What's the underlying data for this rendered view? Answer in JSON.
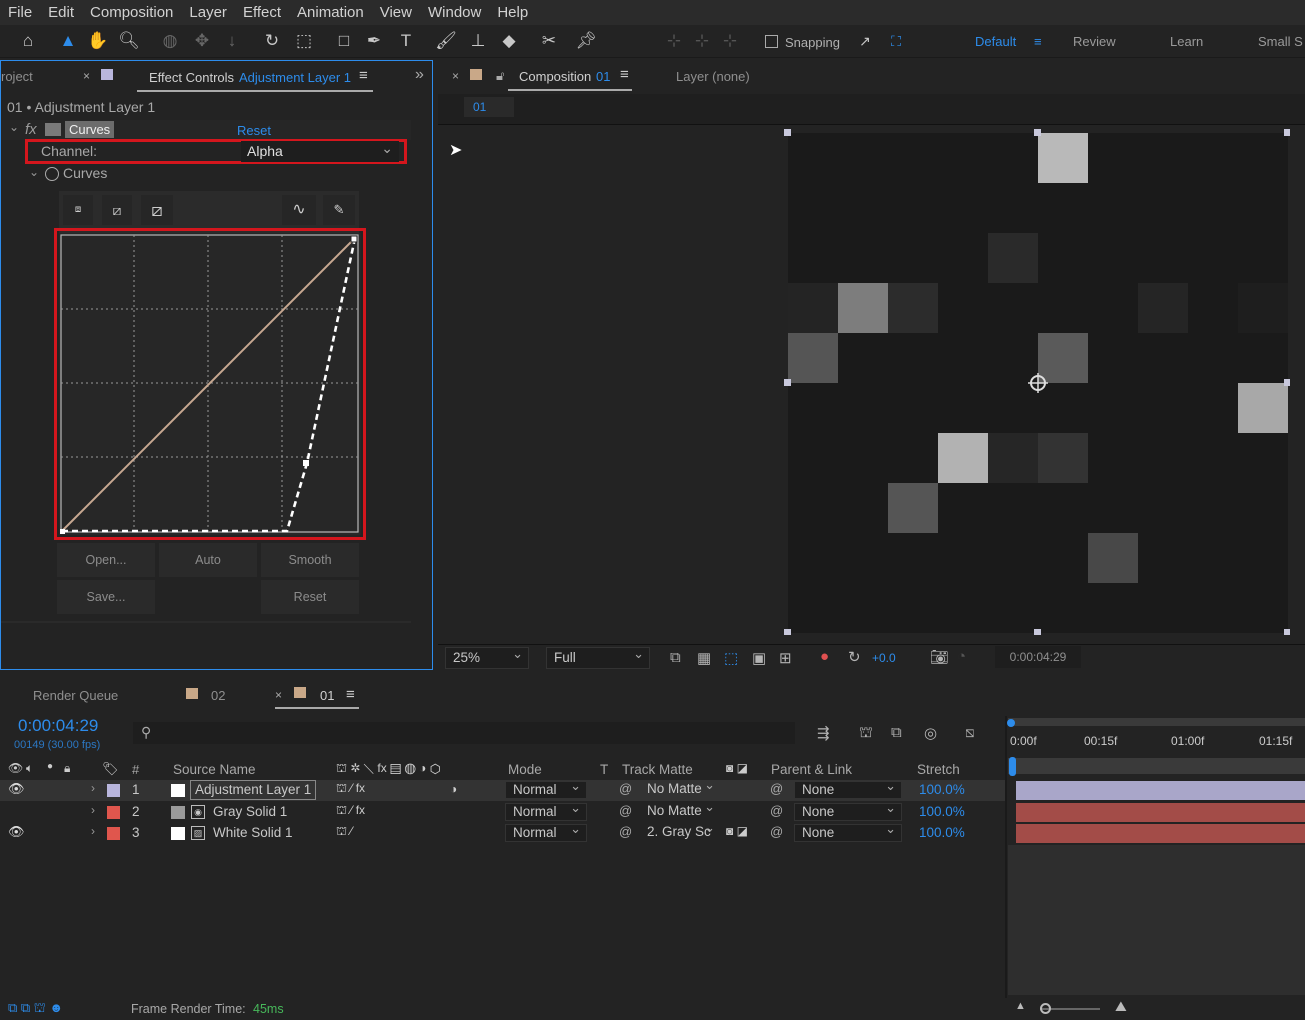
{
  "menu": [
    "File",
    "Edit",
    "Composition",
    "Layer",
    "Effect",
    "Animation",
    "View",
    "Window",
    "Help"
  ],
  "toolbar": {
    "snapping_label": "Snapping",
    "workspaces": [
      "Default",
      "Review",
      "Learn",
      "Small S"
    ]
  },
  "effect_panel": {
    "project_tab": "roject",
    "tab_label": "Effect Controls",
    "tab_layer": "Adjustment Layer 1",
    "breadcrumb": "01 • Adjustment Layer 1",
    "effect_name": "Curves",
    "reset_label": "Reset",
    "channel_label": "Channel:",
    "channel_value": "Alpha",
    "curves_label": "Curves",
    "buttons": {
      "open": "Open...",
      "auto": "Auto",
      "smooth": "Smooth",
      "save": "Save...",
      "reset": "Reset"
    }
  },
  "comp_panel": {
    "tab_label": "Composition",
    "tab_comp": "01",
    "layer_tab": "Layer (none)",
    "sub_tab": "01",
    "zoom": "25%",
    "resolution": "Full",
    "exposure": "+0.0",
    "timecode": "0:00:04:29"
  },
  "timeline": {
    "tabs": [
      "Render Queue",
      "02",
      "01"
    ],
    "timecode": "0:00:04:29",
    "frame_info": "00149 (30.00 fps)",
    "ruler": [
      "0:00f",
      "00:15f",
      "01:00f",
      "01:15f"
    ],
    "columns": {
      "num": "#",
      "source": "Source Name",
      "mode": "Mode",
      "t": "T",
      "track": "Track Matte",
      "parent": "Parent & Link",
      "stretch": "Stretch"
    },
    "layers": [
      {
        "num": "1",
        "name": "Adjustment Layer 1",
        "mode": "Normal",
        "track": "No Matte",
        "parent": "None",
        "stretch": "100.0%",
        "color": "#b9b6dd"
      },
      {
        "num": "2",
        "name": "Gray Solid 1",
        "mode": "Normal",
        "track": "No Matte",
        "parent": "None",
        "stretch": "100.0%",
        "color": "#e0564d"
      },
      {
        "num": "3",
        "name": "White Solid 1",
        "mode": "Normal",
        "track": "2. Gray Sc",
        "parent": "None",
        "stretch": "100.0%",
        "color": "#e0564d"
      }
    ]
  },
  "status": {
    "label": "Frame Render Time:",
    "value": "45ms"
  }
}
